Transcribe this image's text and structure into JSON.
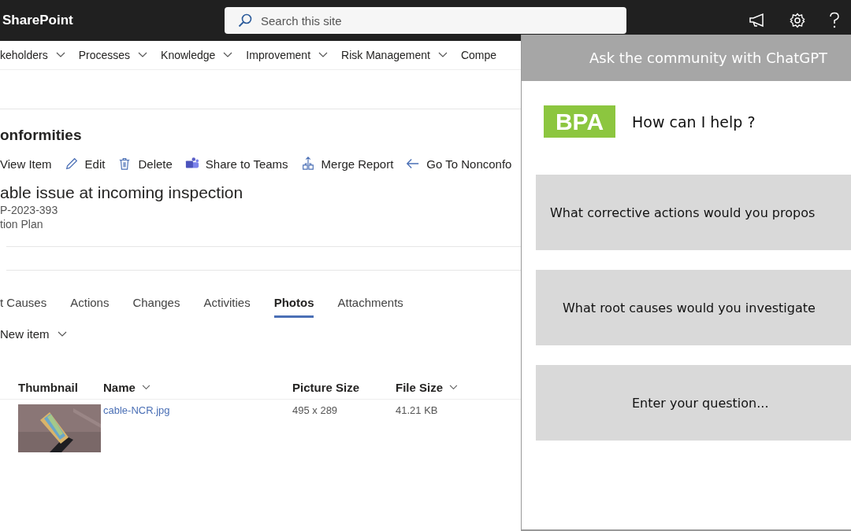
{
  "top_bar": {
    "brand": "SharePoint",
    "search": {
      "placeholder": "Search this site"
    }
  },
  "nav": [
    {
      "label": "keholders",
      "dropdown": true
    },
    {
      "label": "Processes",
      "dropdown": true
    },
    {
      "label": "Knowledge",
      "dropdown": true
    },
    {
      "label": "Improvement",
      "dropdown": true
    },
    {
      "label": "Risk Management",
      "dropdown": true
    },
    {
      "label": "Compe",
      "dropdown": false
    }
  ],
  "list_title": "onformities",
  "commands": [
    {
      "kind": "view",
      "label": "View Item"
    },
    {
      "kind": "edit",
      "label": "Edit"
    },
    {
      "kind": "delete",
      "label": "Delete"
    },
    {
      "kind": "teams",
      "label": "Share to Teams"
    },
    {
      "kind": "merge",
      "label": "Merge Report"
    },
    {
      "kind": "back",
      "label": "Go To Nonconfo"
    }
  ],
  "item": {
    "title": "able issue at incoming inspection",
    "id": "P-2023-393",
    "status": "tion Plan"
  },
  "tabs": [
    {
      "label": "t Causes",
      "selected": false
    },
    {
      "label": "Actions",
      "selected": false
    },
    {
      "label": "Changes",
      "selected": false
    },
    {
      "label": "Activities",
      "selected": false
    },
    {
      "label": "Photos",
      "selected": true
    },
    {
      "label": "Attachments",
      "selected": false
    }
  ],
  "new_item": "New item",
  "table": {
    "columns": [
      {
        "label": "Thumbnail",
        "sortable": false
      },
      {
        "label": "Name",
        "sortable": true
      },
      {
        "label": "Picture Size",
        "sortable": false
      },
      {
        "label": "File Size",
        "sortable": true
      }
    ],
    "rows": [
      {
        "name": "cable-NCR.jpg",
        "picture_size": "495 x 289",
        "file_size": "41.21 KB"
      }
    ]
  },
  "chat_panel": {
    "title": "Ask the community with ChatGPT",
    "logo": "BPA",
    "greeting": "How can I help ?",
    "prompts": [
      {
        "kind": "suggestion",
        "text": "What corrective actions would you propos"
      },
      {
        "kind": "suggestion",
        "text": "What root causes would you investigate"
      },
      {
        "kind": "input",
        "text": "Enter your question..."
      }
    ]
  }
}
